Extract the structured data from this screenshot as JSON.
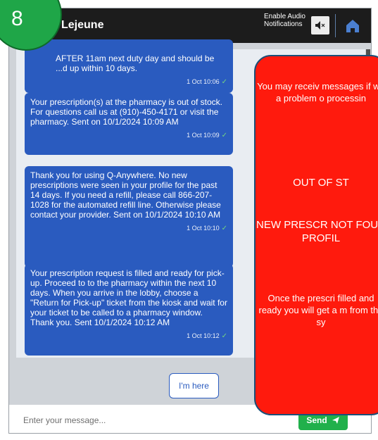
{
  "header": {
    "title": "Lejeune",
    "audio_label": "Enable Audio Notifications",
    "mute_icon": "mute-speaker-icon",
    "home_icon": "home-icon"
  },
  "messages": [
    {
      "text": "AFTER 11am next duty day and should be ...d up within 10 days.",
      "time": "1 Oct 10:06"
    },
    {
      "text": "Your prescription(s) at the pharmacy is out of stock. For questions call us at (910)-450-4171 or visit the pharmacy. Sent on 10/1/2024 10:09 AM",
      "time": "1 Oct 10:09"
    },
    {
      "text": "Thank you for using Q-Anywhere. No new prescriptions were seen in your profile for the past 14 days. If you need a refill, please call 866-207-1028 for the automated refill line. Otherwise please contact your provider. Sent on 10/1/2024 10:10 AM",
      "time": "1 Oct 10:10"
    },
    {
      "text": "Your prescription request is filled and ready for pick-up. Proceed to to the pharmacy within the next 10 days. When you arrive in the lobby, choose a \"Return for Pick-up\" ticket from the kiosk and wait for your ticket to be called to a pharmacy window. Thank you. Sent 10/1/2024 10:12 AM",
      "time": "1 Oct 10:12"
    }
  ],
  "im_here_label": "I'm here",
  "input": {
    "placeholder": "Enter your message...",
    "value": ""
  },
  "send_label": "Send",
  "callout": {
    "line1": "You may receiv messages if we a problem o processin",
    "line2": "OUT OF ST",
    "line3": "NEW PRESCR NOT FOUN PROFIL",
    "line4": "Once the prescri filled and ready you will get a m from the sy"
  },
  "step_number": "8",
  "colors": {
    "header_bg": "#1c1c1c",
    "bubble": "#2a5bbf",
    "send": "#21b04b",
    "callout": "#ff1a0d",
    "badge": "#1fa648"
  }
}
